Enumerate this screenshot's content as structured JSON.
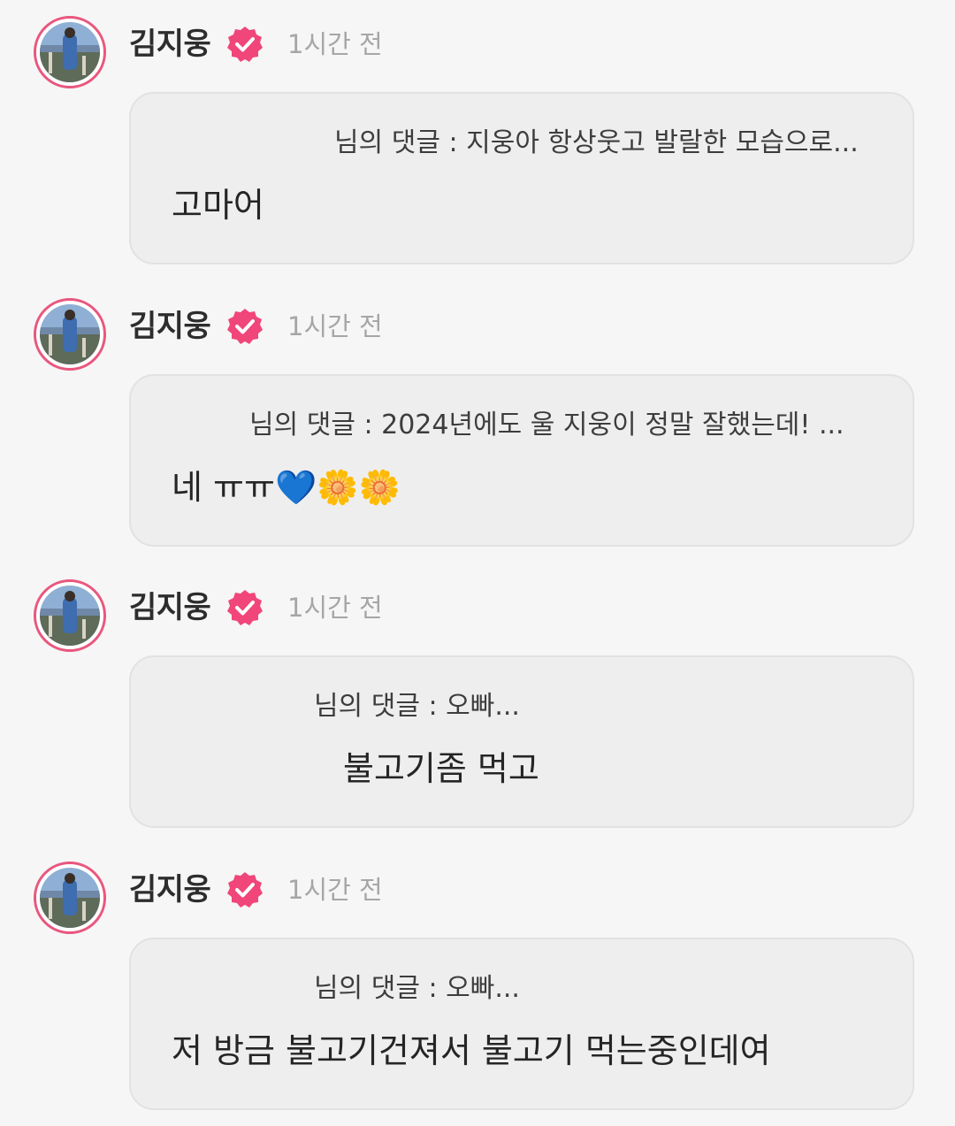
{
  "comments": [
    {
      "author": "김지웅",
      "time": "1시간 전",
      "quote": "님의 댓글 : 지웅아 항상웃고 발랄한 모습으로...",
      "reply": "고마어"
    },
    {
      "author": "김지웅",
      "time": "1시간 전",
      "quote": "님의 댓글 : 2024년에도 울 지웅이 정말 잘했는데! ...",
      "reply": "네 ㅠㅠ💙🌼🌼"
    },
    {
      "author": "김지웅",
      "time": "1시간 전",
      "quote": "님의 댓글 : 오빠...",
      "reply": "불고기좀 먹고"
    },
    {
      "author": "김지웅",
      "time": "1시간 전",
      "quote": "님의 댓글 : 오빠...",
      "reply": "저 방금 불고기건져서 불고기 먹는중인데여"
    }
  ],
  "icons": {
    "verified": "verified-badge-icon",
    "avatar": "profile-photo"
  },
  "colors": {
    "verified_pink": "#f0467a",
    "avatar_ring": "#e9577e",
    "bubble_bg": "#eeeeee",
    "timestamp": "#a6a6a6"
  }
}
